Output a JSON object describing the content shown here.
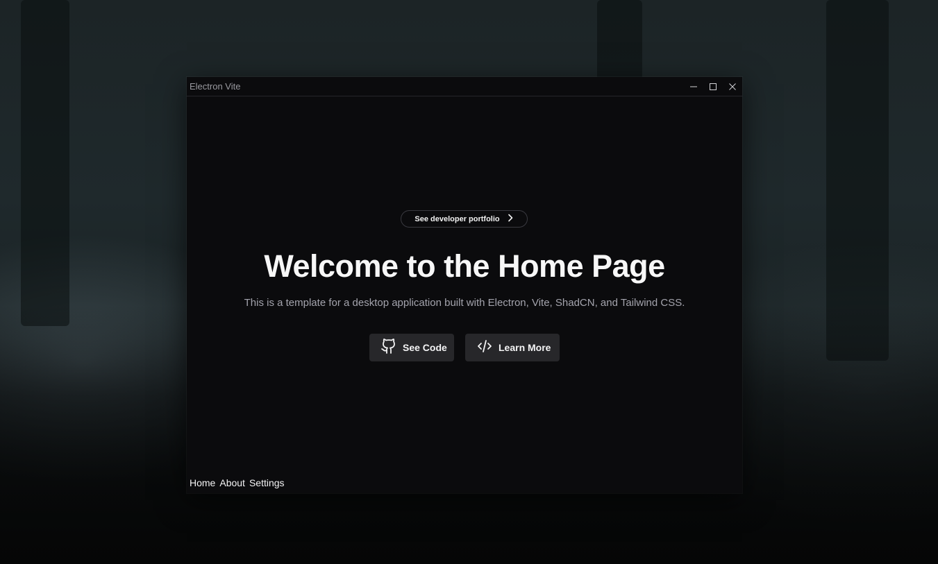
{
  "window": {
    "title": "Electron Vite",
    "controls": {
      "minimize_icon": "minimize-icon",
      "maximize_icon": "maximize-icon",
      "close_icon": "close-icon"
    }
  },
  "hero": {
    "portfolio_link": {
      "label": "See developer portfolio",
      "icon": "chevron-right-icon"
    },
    "heading": "Welcome to the Home Page",
    "subtitle": "This is a template for a desktop application built with Electron, Vite, ShadCN, and Tailwind CSS.",
    "buttons": [
      {
        "label": "See Code",
        "icon": "github-icon"
      },
      {
        "label": "Learn More",
        "icon": "code-icon"
      }
    ]
  },
  "nav": {
    "items": [
      "Home",
      "About",
      "Settings"
    ]
  },
  "colors": {
    "window_bg": "#0b0b0d",
    "button_bg": "#27272a",
    "heading": "#f7f7f7",
    "subtitle": "#a4a4ad"
  }
}
